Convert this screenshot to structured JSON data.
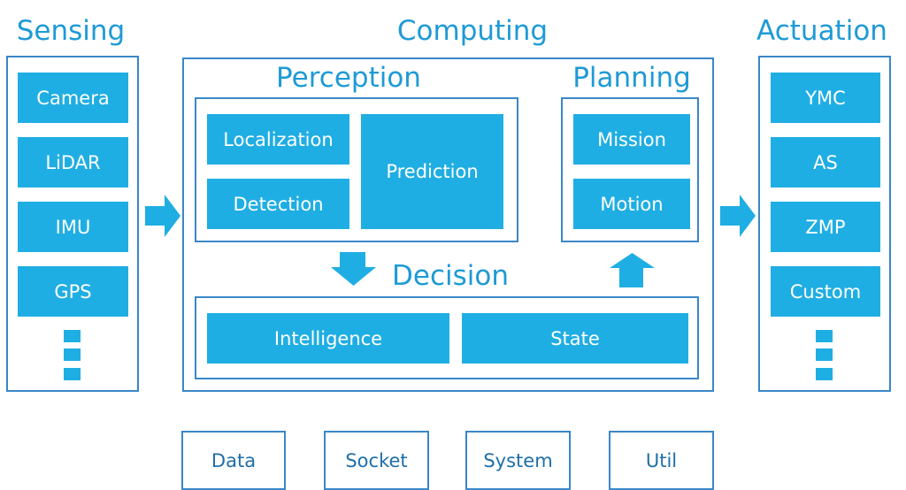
{
  "colors": {
    "fill": "#1FAEE3",
    "border": "#3A87C8",
    "title": "#1E9AD6"
  },
  "sensing": {
    "title": "Sensing",
    "items": [
      "Camera",
      "LiDAR",
      "IMU",
      "GPS"
    ]
  },
  "computing": {
    "title": "Computing",
    "perception": {
      "title": "Perception",
      "localization": "Localization",
      "detection": "Detection",
      "prediction": "Prediction"
    },
    "planning": {
      "title": "Planning",
      "mission": "Mission",
      "motion": "Motion"
    },
    "decision": {
      "title": "Decision",
      "intelligence": "Intelligence",
      "state": "State"
    }
  },
  "actuation": {
    "title": "Actuation",
    "items": [
      "YMC",
      "AS",
      "ZMP",
      "Custom"
    ]
  },
  "utilities": [
    "Data",
    "Socket",
    "System",
    "Util"
  ]
}
